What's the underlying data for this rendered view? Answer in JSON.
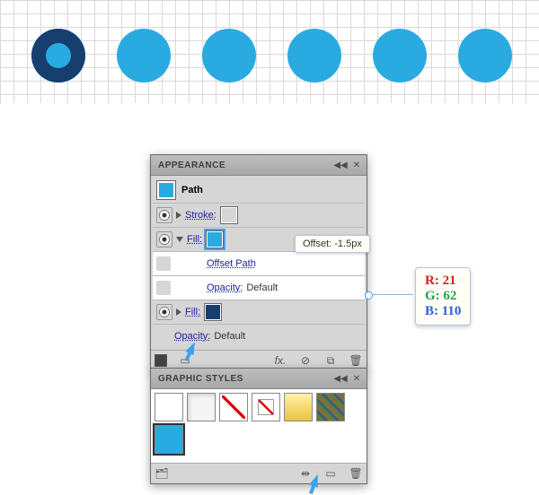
{
  "canvas": {
    "dot_color": "#29abe2",
    "ring_color": "#163e6e",
    "dots": [
      "ring",
      "plain",
      "plain",
      "plain",
      "plain",
      "plain"
    ]
  },
  "appearance": {
    "title": "APPEARANCE",
    "object_type": "Path",
    "object_swatch": "#29abe2",
    "stroke_label": "Stroke:",
    "fill_label": "Fill:",
    "fill1_color": "#29abe2",
    "offset_path_label": "Offset Path",
    "offset_tooltip": "Offset: -1.5px",
    "opacity_label": "Opacity:",
    "opacity_value": "Default",
    "fill2_color": "#163e6e"
  },
  "rgb_callout": {
    "r_label": "R:",
    "r_value": "21",
    "g_label": "G:",
    "g_value": "62",
    "b_label": "B:",
    "b_value": "110"
  },
  "graphic_styles": {
    "title": "GRAPHIC STYLES",
    "items": [
      {
        "type": "blank"
      },
      {
        "type": "white"
      },
      {
        "type": "none"
      },
      {
        "type": "none-small"
      },
      {
        "type": "gold"
      },
      {
        "type": "texture"
      },
      {
        "type": "cyan_selected"
      }
    ]
  }
}
